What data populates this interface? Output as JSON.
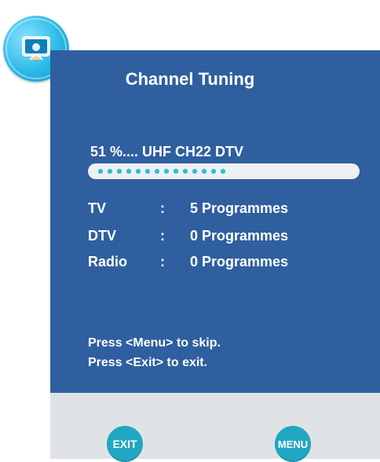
{
  "header": {
    "title": "Channel Tuning"
  },
  "scan": {
    "status_text": "51 %.... UHF CH22 DTV",
    "progress": 0.51
  },
  "results": [
    {
      "label": "TV",
      "colon": ":",
      "value": "5 Programmes"
    },
    {
      "label": "DTV",
      "colon": ":",
      "value": "0 Programmes"
    },
    {
      "label": "Radio",
      "colon": ":",
      "value": "0 Programmes"
    }
  ],
  "hints": {
    "skip": "Press <Menu> to skip.",
    "exit": "Press <Exit> to exit."
  },
  "buttons": {
    "exit": "EXIT",
    "menu": "MENU"
  },
  "icons": {
    "corner": "tv-setup-icon"
  },
  "colors": {
    "panel": "#2f5f9f",
    "accent": "#21a7c2"
  }
}
